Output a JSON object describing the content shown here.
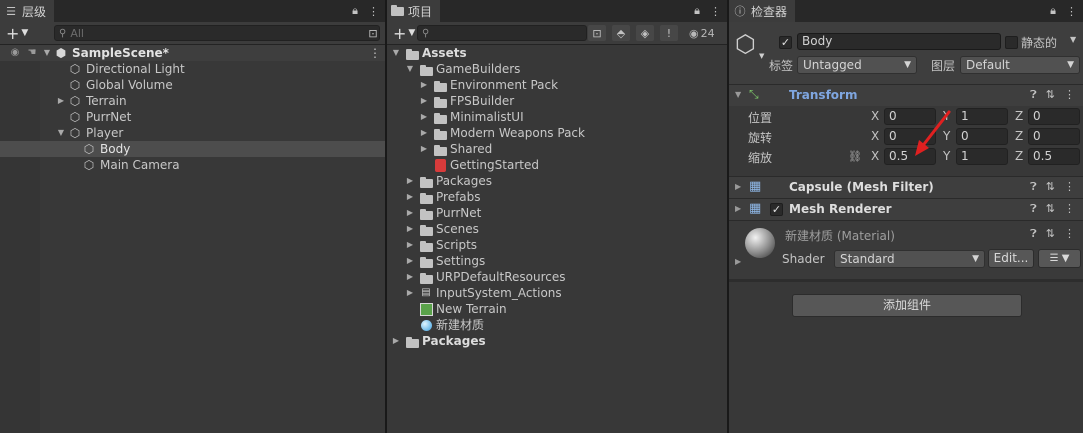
{
  "hierarchy": {
    "tab_label": "层级",
    "search_placeholder": "All",
    "scene": "SampleScene*",
    "items": [
      "Directional Light",
      "Global Volume",
      "Terrain",
      "PurrNet",
      "Player",
      "Body",
      "Main Camera"
    ]
  },
  "project": {
    "tab_label": "项目",
    "hidden_count": "24",
    "tree": [
      "Assets",
      "GameBuilders",
      "Environment Pack",
      "FPSBuilder",
      "MinimalistUI",
      "Modern Weapons Pack",
      "Shared",
      "GettingStarted",
      "Packages",
      "Prefabs",
      "PurrNet",
      "Scenes",
      "Scripts",
      "Settings",
      "URPDefaultResources",
      "InputSystem_Actions",
      "New Terrain",
      "新建材质",
      "Packages"
    ]
  },
  "inspector": {
    "tab_label": "检查器",
    "object_name": "Body",
    "static_label": "静态的",
    "tag_label": "标签",
    "tag_value": "Untagged",
    "layer_label": "图层",
    "layer_value": "Default",
    "transform": {
      "title": "Transform",
      "position_label": "位置",
      "rotation_label": "旋转",
      "scale_label": "缩放",
      "axes": [
        "X",
        "Y",
        "Z"
      ],
      "position": [
        "0",
        "1",
        "0"
      ],
      "rotation": [
        "0",
        "0",
        "0"
      ],
      "scale": [
        "0.5",
        "1",
        "0.5"
      ]
    },
    "mesh_filter_title": "Capsule (Mesh Filter)",
    "mesh_renderer_title": "Mesh Renderer",
    "material": {
      "name": "新建材质 (Material)",
      "shader_label": "Shader",
      "shader_value": "Standard",
      "edit_label": "Edit..."
    },
    "add_component_label": "添加组件"
  },
  "colors": {
    "accent_blue": "#7fa6e0",
    "annotation_arrow": "#e02020"
  }
}
